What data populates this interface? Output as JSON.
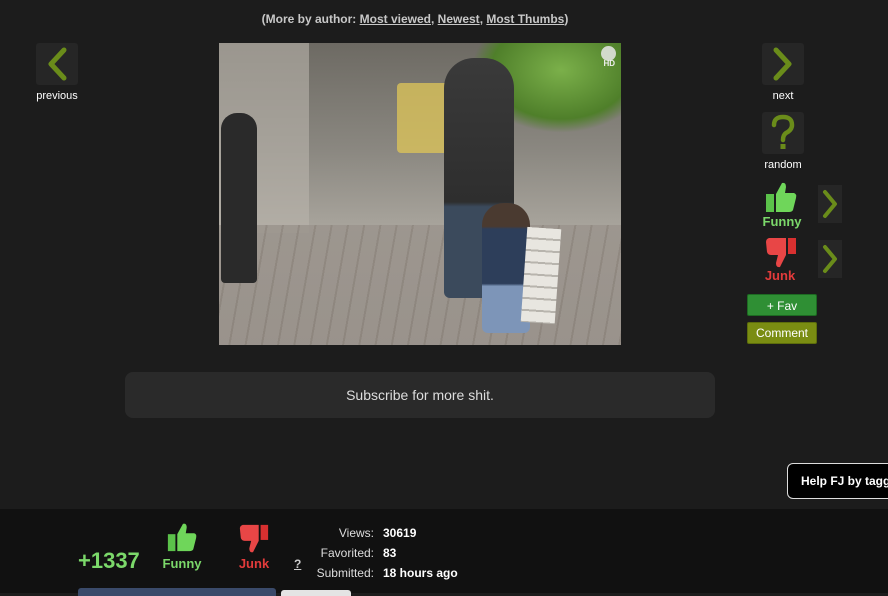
{
  "author_line": {
    "prefix": "(More by author: ",
    "link_most_viewed": "Most viewed",
    "sep1": ", ",
    "link_newest": "Newest",
    "sep2": ", ",
    "link_most_thumbs": "Most Thumbs",
    "suffix": ")"
  },
  "nav": {
    "previous_label": "previous",
    "next_label": "next",
    "random_label": "random"
  },
  "media": {
    "hd_badge": "HD"
  },
  "voting": {
    "funny_label": "Funny",
    "junk_label": "Junk",
    "fav_label": "+ Fav",
    "comment_label": "Comment"
  },
  "subscribe": {
    "text": "Subscribe for more shit."
  },
  "help": {
    "label": "Help FJ by tagg"
  },
  "stats_bar": {
    "score": "+1337",
    "funny_label": "Funny",
    "junk_label": "Junk",
    "help_q": "?",
    "views_label": "Views:",
    "views_value": "30619",
    "favorited_label": "Favorited:",
    "favorited_value": "83",
    "submitted_label": "Submitted:",
    "submitted_value": "18 hours ago"
  },
  "colors": {
    "background": "#1c1c1c",
    "nav_arrow": "#6a8c1a",
    "funny_green": "#7bd86a",
    "junk_red": "#e23b3b",
    "fav_green": "#2f8f34",
    "comment_olive": "#7a8d12"
  },
  "icons": [
    "chevron-left-icon",
    "chevron-right-icon",
    "question-mark-icon",
    "thumbs-up-icon",
    "thumbs-down-icon"
  ]
}
